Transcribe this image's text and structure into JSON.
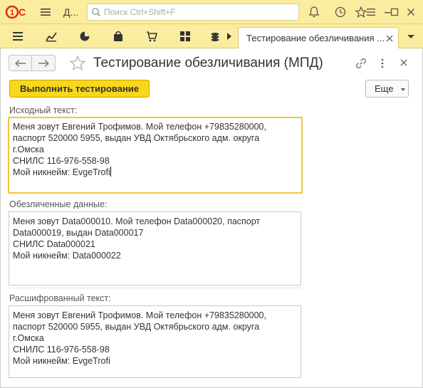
{
  "app": {
    "logo": "1С",
    "app_name": "Д...",
    "search_placeholder": "Поиск Ctrl+Shift+F"
  },
  "titlebar_icons": [
    "bell-icon",
    "history-icon",
    "favorites-star-icon",
    "menu-lines-icon",
    "minimize-icon",
    "maximize-icon",
    "close-icon"
  ],
  "toolbar_icons": [
    "list-icon",
    "chart-icon",
    "pie-icon",
    "bag-icon",
    "cart-icon",
    "grid-icon",
    "coins-icon"
  ],
  "tab": {
    "title": "Тестирование обезличивания ..."
  },
  "form": {
    "title": "Тестирование обезличивания (МПД)",
    "run_button": "Выполнить тестирование",
    "more_button": "Еще",
    "source_label": "Исходный текст:",
    "source_lines": [
      "Меня зовут Евгений Трофимов. Мой телефон +79835280000,",
      "паспорт 520000 5955, выдан УВД Октябрьского адм. округа",
      "г.Омска",
      "СНИЛС 116-976-558-98",
      "Мой никнейм: EvgeTrofi"
    ],
    "anon_label": "Обезличенные данные:",
    "anon_lines": [
      "Меня зовут Data000010. Мой телефон Data000020, паспорт",
      "Data000019, выдан Data000017",
      "СНИЛС Data000021",
      "Мой никнейм: Data000022"
    ],
    "decoded_label": "Расшифрованный текст:",
    "decoded_lines": [
      "Меня зовут Евгений Трофимов. Мой телефон +79835280000,",
      "паспорт 520000 5955, выдан УВД Октябрьского адм. округа",
      "г.Омска",
      "СНИЛС 116-976-558-98",
      "Мой никнейм: EvgeTrofi"
    ]
  },
  "colors": {
    "header_bg": "#fbed9e",
    "primary_button": "#f9d71c",
    "focus_border": "#f0c63a",
    "logo_red": "#e3291b"
  }
}
